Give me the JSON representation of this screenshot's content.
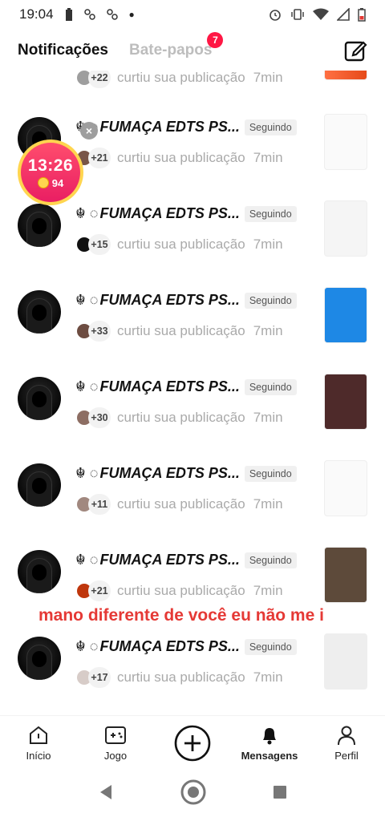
{
  "status_bar": {
    "time": "19:04"
  },
  "tabs": {
    "notifications": "Notificações",
    "chats": "Bate-papos",
    "chats_badge": "7"
  },
  "timer": {
    "time": "13:26",
    "coins": "94"
  },
  "partial_row": {
    "count": "+22",
    "text": "curtiu sua publicação",
    "time": "7min"
  },
  "notifications": [
    {
      "deco": "☬ ◌",
      "name": "FUMAÇA EDTS PS...",
      "badge": "Seguindo",
      "count": "+21",
      "text": "curtiu sua publicação",
      "time": "7min",
      "mini_color": "#795548",
      "thumb_bg": "#fafafa"
    },
    {
      "deco": "☬ ◌",
      "name": "FUMAÇA EDTS PS...",
      "badge": "Seguindo",
      "count": "+15",
      "text": "curtiu sua publicação",
      "time": "7min",
      "mini_color": "#111111",
      "thumb_bg": "#f5f5f5"
    },
    {
      "deco": "☬ ◌",
      "name": "FUMAÇA EDTS PS...",
      "badge": "Seguindo",
      "count": "+33",
      "text": "curtiu sua publicação",
      "time": "7min",
      "mini_color": "#6d4c41",
      "thumb_bg": "#1e88e5"
    },
    {
      "deco": "☬ ◌",
      "name": "FUMAÇA EDTS PS...",
      "badge": "Seguindo",
      "count": "+30",
      "text": "curtiu sua publicação",
      "time": "7min",
      "mini_color": "#8d6e63",
      "thumb_bg": "#4e2a2a"
    },
    {
      "deco": "☬ ◌",
      "name": "FUMAÇA EDTS PS...",
      "badge": "Seguindo",
      "count": "+11",
      "text": "curtiu sua publicação",
      "time": "7min",
      "mini_color": "#a1887f",
      "thumb_bg": "#fafafa"
    },
    {
      "deco": "☬ ◌",
      "name": "FUMAÇA EDTS PS...",
      "badge": "Seguindo",
      "count": "+21",
      "text": "curtiu sua publicação",
      "time": "7min",
      "mini_color": "#bf360c",
      "thumb_bg": "#5d4a3a"
    },
    {
      "deco": "☬ ◌",
      "name": "FUMAÇA EDTS PS...",
      "badge": "Seguindo",
      "count": "+17",
      "text": "curtiu sua publicação",
      "time": "7min",
      "mini_color": "#d7ccc8",
      "thumb_bg": "#eeeeee"
    }
  ],
  "caption": "mano diferente de você eu não me i",
  "bottom_nav": {
    "home": "Início",
    "game": "Jogo",
    "messages": "Mensagens",
    "profile": "Perfil"
  },
  "colors": {
    "accent": "#ff1744",
    "caption_red": "#e53935",
    "muted_text": "#aaaaaa"
  }
}
